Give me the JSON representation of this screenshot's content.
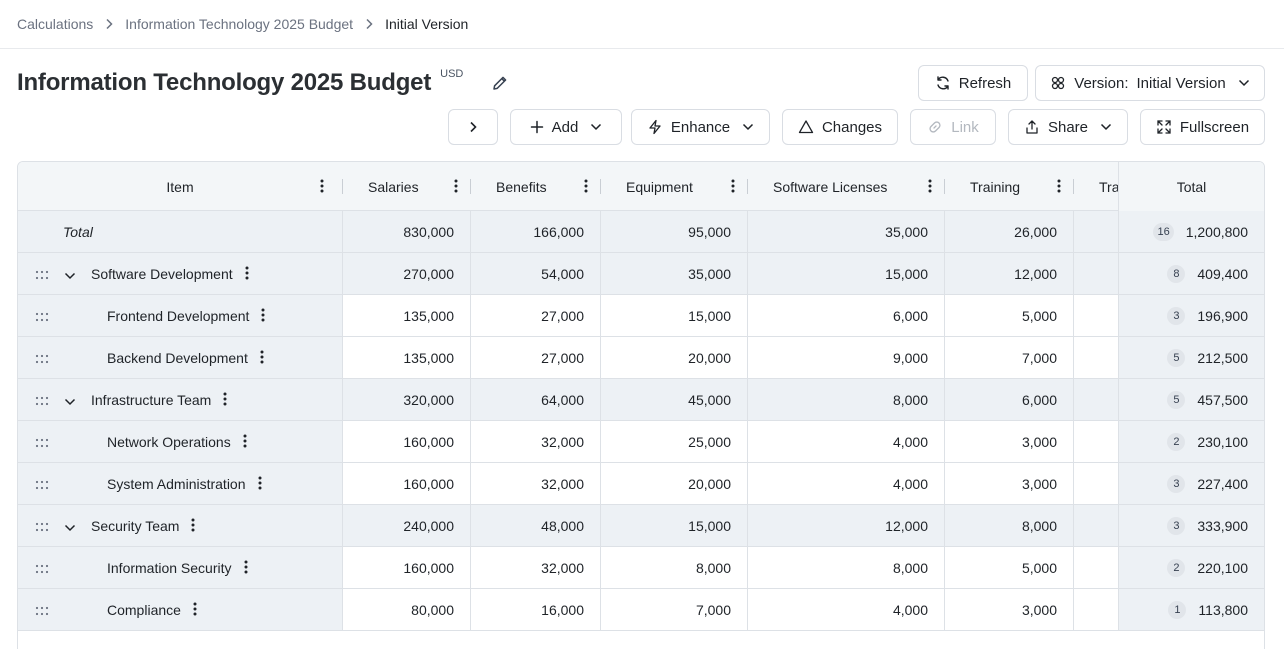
{
  "breadcrumb": {
    "items": [
      "Calculations",
      "Information Technology 2025 Budget",
      "Initial Version"
    ]
  },
  "title": {
    "text": "Information Technology 2025 Budget",
    "currency": "USD"
  },
  "toolbar": {
    "refresh_label": "Refresh",
    "version_label": "Version:",
    "version_value": "Initial Version",
    "add_label": "Add",
    "enhance_label": "Enhance",
    "changes_label": "Changes",
    "link_label": "Link",
    "share_label": "Share",
    "fullscreen_label": "Fullscreen"
  },
  "table": {
    "columns": [
      "Item",
      "Salaries",
      "Benefits",
      "Equipment",
      "Software Licenses",
      "Training",
      "Tra",
      "Total"
    ],
    "total_row": {
      "label": "Total",
      "values": [
        "830,000",
        "166,000",
        "95,000",
        "35,000",
        "26,000"
      ],
      "count": "16",
      "total": "1,200,800"
    },
    "rows": [
      {
        "label": "Software Development",
        "group": true,
        "values": [
          "270,000",
          "54,000",
          "35,000",
          "15,000",
          "12,000"
        ],
        "count": "8",
        "total": "409,400"
      },
      {
        "label": "Frontend Development",
        "group": false,
        "values": [
          "135,000",
          "27,000",
          "15,000",
          "6,000",
          "5,000"
        ],
        "count": "3",
        "total": "196,900"
      },
      {
        "label": "Backend Development",
        "group": false,
        "values": [
          "135,000",
          "27,000",
          "20,000",
          "9,000",
          "7,000"
        ],
        "count": "5",
        "total": "212,500"
      },
      {
        "label": "Infrastructure Team",
        "group": true,
        "values": [
          "320,000",
          "64,000",
          "45,000",
          "8,000",
          "6,000"
        ],
        "count": "5",
        "total": "457,500"
      },
      {
        "label": "Network Operations",
        "group": false,
        "values": [
          "160,000",
          "32,000",
          "25,000",
          "4,000",
          "3,000"
        ],
        "count": "2",
        "total": "230,100"
      },
      {
        "label": "System Administration",
        "group": false,
        "values": [
          "160,000",
          "32,000",
          "20,000",
          "4,000",
          "3,000"
        ],
        "count": "3",
        "total": "227,400"
      },
      {
        "label": "Security Team",
        "group": true,
        "values": [
          "240,000",
          "48,000",
          "15,000",
          "12,000",
          "8,000"
        ],
        "count": "3",
        "total": "333,900"
      },
      {
        "label": "Information Security",
        "group": false,
        "values": [
          "160,000",
          "32,000",
          "8,000",
          "8,000",
          "5,000"
        ],
        "count": "2",
        "total": "220,100"
      },
      {
        "label": "Compliance",
        "group": false,
        "values": [
          "80,000",
          "16,000",
          "7,000",
          "4,000",
          "3,000"
        ],
        "count": "1",
        "total": "113,800"
      }
    ]
  }
}
